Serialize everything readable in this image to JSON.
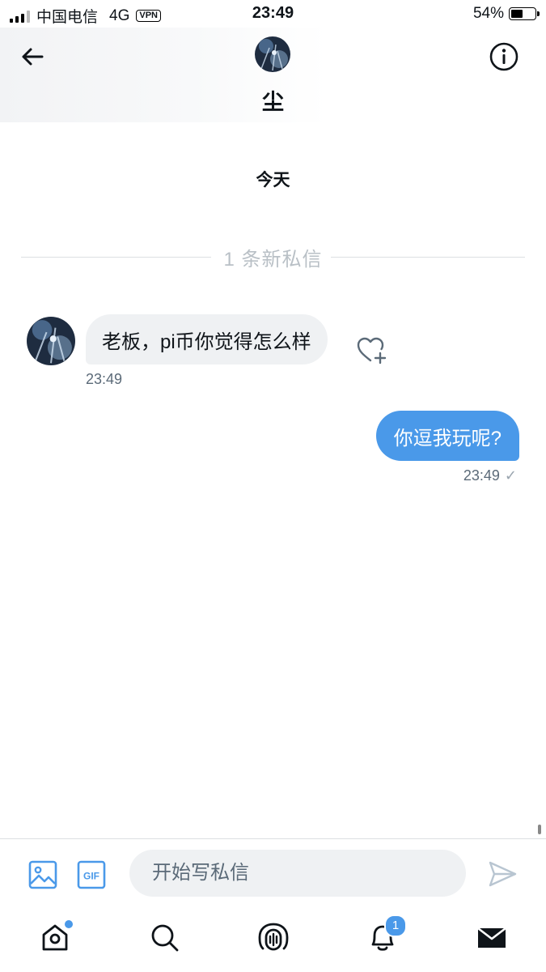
{
  "status_bar": {
    "carrier": "中国电信",
    "network": "4G",
    "vpn": "VPN",
    "time": "23:49",
    "battery": "54%",
    "battery_level": 0.54
  },
  "header": {
    "contact_name": "尘",
    "back_icon": "arrow-left-icon",
    "info_icon": "info-circle-icon"
  },
  "conversation": {
    "date_label": "今天",
    "new_messages_divider": "1 条新私信",
    "messages": [
      {
        "direction": "incoming",
        "text": "老板，pi币你觉得怎么样",
        "time": "23:49"
      },
      {
        "direction": "outgoing",
        "text": "你逗我玩呢?",
        "time": "23:49",
        "status": "✓"
      }
    ]
  },
  "composer": {
    "placeholder": "开始写私信",
    "value": "",
    "gif_label": "GIF",
    "image_icon": "image-icon",
    "send_icon": "send-icon"
  },
  "tabbar": {
    "notifications_badge": "1",
    "tabs": [
      "home-icon",
      "search-icon",
      "spaces-icon",
      "notifications-icon",
      "messages-icon"
    ]
  },
  "colors": {
    "accent": "#4a99e9",
    "incoming_bubble": "#eff1f3",
    "muted_text": "#5b6a78",
    "divider_text": "#b9c0c6"
  }
}
